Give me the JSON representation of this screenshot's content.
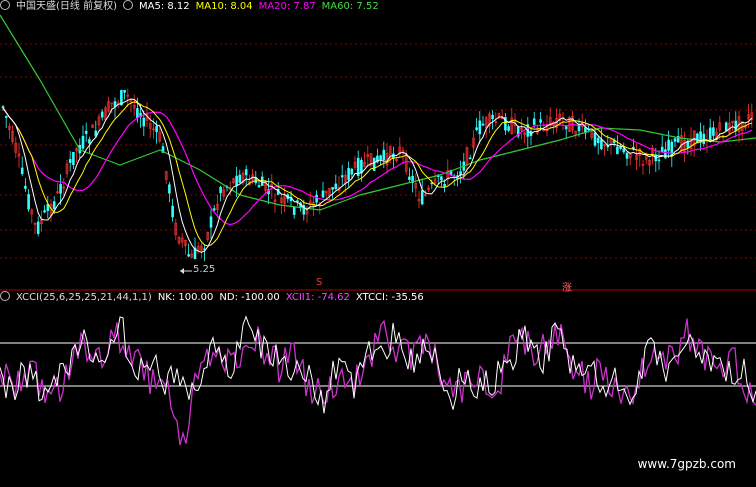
{
  "main_panel": {
    "title": "中国天盛(日线 前复权)",
    "ma": [
      {
        "label": "MA5: 8.12",
        "color": "#ffffff"
      },
      {
        "label": "MA10: 8.04",
        "color": "#ffff00"
      },
      {
        "label": "MA20: 7.87",
        "color": "#ff00ff"
      },
      {
        "label": "MA60: 7.52",
        "color": "#00ff00"
      }
    ],
    "min_price_label": "5.25",
    "marker_left": "S",
    "marker_right": "涨"
  },
  "indicator_panel": {
    "title": "XCCI(25,6,25,25,21,44,1,1)",
    "nk": "NK: 100.00",
    "nd": "ND: -100.00",
    "xcci1": "XCII1: -74.62",
    "xtcci": "XTCCI: -35.56"
  },
  "watermark": "www.7gpzb.com",
  "colors": {
    "up": "#ff3333",
    "down": "#33ffff",
    "ma5": "#ffffff",
    "ma10": "#ffff00",
    "ma20": "#ff00ff",
    "ma60": "#33cc33",
    "grid": "#8a0000",
    "level": "#ffffff"
  }
}
